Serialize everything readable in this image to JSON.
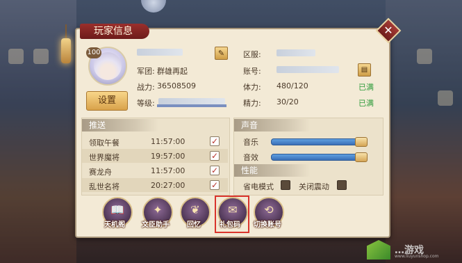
{
  "panel": {
    "title": "玩家信息",
    "close_symbol": "✕"
  },
  "profile": {
    "level": "100",
    "name_label": "",
    "legion_label": "军团:",
    "legion_value": "群雄再起",
    "power_label": "战力:",
    "power_value": "36508509",
    "rank_label": "等级:",
    "settings_label": "设置",
    "edit_symbol": "✎"
  },
  "server": {
    "zone_label": "区服:",
    "account_label": "账号:",
    "copy_symbol": "▤",
    "stamina_label": "体力:",
    "stamina_value": "480/120",
    "stamina_status": "已满",
    "energy_label": "精力:",
    "energy_value": "30/20",
    "energy_status": "已满"
  },
  "push": {
    "header": "推送",
    "items": [
      {
        "name": "领取午餐",
        "time": "11:57:00",
        "checked": "✓"
      },
      {
        "name": "世界魔将",
        "time": "19:57:00",
        "checked": "✓"
      },
      {
        "name": "赛龙舟",
        "time": "11:57:00",
        "checked": "✓"
      },
      {
        "name": "乱世名将",
        "time": "20:27:00",
        "checked": "✓"
      }
    ]
  },
  "sound": {
    "header": "声音",
    "music_label": "音乐",
    "effect_label": "音效",
    "music_level": 0.95,
    "effect_level": 0.95
  },
  "performance": {
    "header": "性能",
    "power_save_label": "省电模式",
    "vibration_label": "关闭震动"
  },
  "bottom_buttons": [
    {
      "label": "天机阁",
      "glyph": "📖"
    },
    {
      "label": "文臣助手",
      "glyph": "✦"
    },
    {
      "label": "回忆",
      "glyph": "❦"
    },
    {
      "label": "礼包码",
      "glyph": "✉"
    },
    {
      "label": "切换账号",
      "glyph": "⟲"
    }
  ],
  "watermark": {
    "text": "…游戏",
    "url": "www.liuyunshop.com"
  },
  "colors": {
    "panel_bg": "#f3ead6",
    "accent_red": "#9a2f2c",
    "status_green": "#2e9b3b",
    "highlight": "#d9342c"
  }
}
